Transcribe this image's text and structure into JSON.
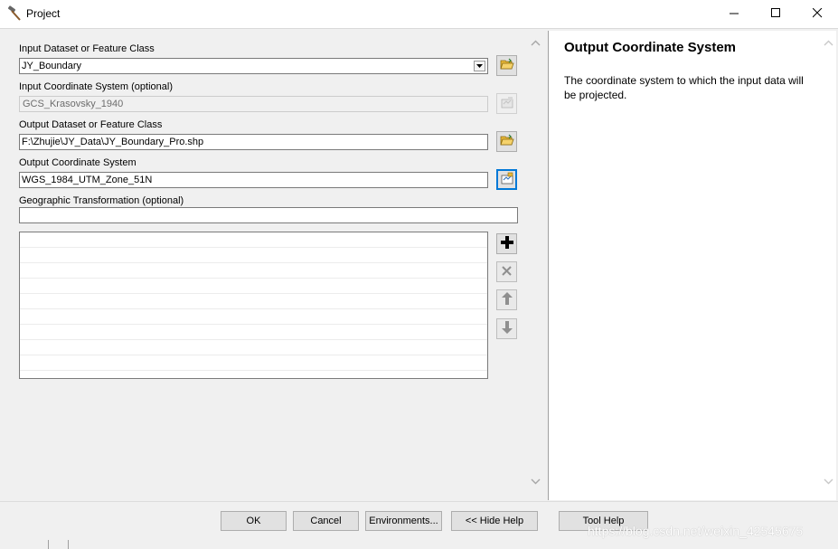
{
  "window": {
    "title": "Project",
    "icon": "hammer-icon",
    "controls": [
      "minimize-icon",
      "maximize-icon",
      "close-icon"
    ]
  },
  "form": {
    "input_dataset": {
      "label": "Input Dataset or Feature Class",
      "value": "JY_Boundary"
    },
    "input_cs": {
      "label": "Input Coordinate System (optional)",
      "value": "GCS_Krasovsky_1940"
    },
    "output_dataset": {
      "label": "Output Dataset or Feature Class",
      "value": "F:\\Zhujie\\JY_Data\\JY_Boundary_Pro.shp"
    },
    "output_cs": {
      "label": "Output Coordinate System",
      "value": "WGS_1984_UTM_Zone_51N"
    },
    "geo_transform": {
      "label": "Geographic Transformation (optional)",
      "value": ""
    },
    "list_rows": [
      "",
      "",
      "",
      "",
      "",
      "",
      "",
      "",
      ""
    ]
  },
  "help": {
    "title": "Output Coordinate System",
    "body": "The coordinate system to which the input data will be projected."
  },
  "buttons": {
    "ok": "OK",
    "cancel": "Cancel",
    "environments": "Environments...",
    "hide_help": "<< Hide Help",
    "tool_help": "Tool Help"
  },
  "watermark": "https://blog.csdn.net/weixin_42545675",
  "colors": {
    "focus": "#0078d7",
    "folder": "#e8b838",
    "panel": "#f0f0f0"
  }
}
